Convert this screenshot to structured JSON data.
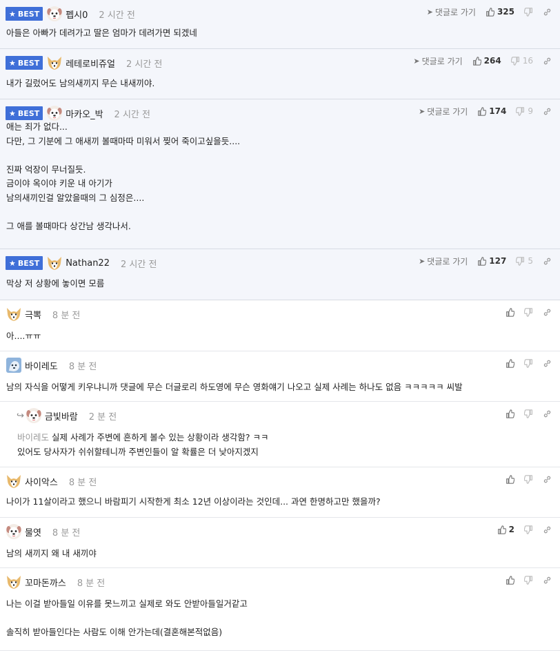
{
  "labels": {
    "best": "BEST",
    "goto": "댓글로 가기"
  },
  "comments": [
    {
      "nick": "펩시0",
      "time": "2 시간 전",
      "best": true,
      "avatar": "dog-face",
      "up": "325",
      "down": "",
      "lines": [
        "아들은 아빠가 데려가고 딸은 엄마가 데려가면 되겠네"
      ]
    },
    {
      "nick": "레테로비쥬얼",
      "time": "2 시간 전",
      "best": true,
      "avatar": "fox-face",
      "up": "264",
      "down": "16",
      "lines": [
        "내가 길렀어도 남의새끼지 무슨 내새끼야."
      ]
    },
    {
      "nick": "마카오_박",
      "time": "2 시간 전",
      "best": true,
      "avatar": "dog-face",
      "up": "174",
      "down": "9",
      "lines": [
        "애는 죄가 없다...",
        "다만, 그 기분에 그 애새끼 볼때마따 미워서 찢어 죽이고싶을듯....",
        "",
        "진짜 억장이 무너질듯.",
        "금이야 옥이야 키운 내 아기가",
        "남의새끼인걸 알았을때의 그 심정은....",
        "",
        "그 애를 볼때마다 상간남 생각나서."
      ]
    },
    {
      "nick": "Nathan22",
      "time": "2 시간 전",
      "best": true,
      "avatar": "fox-face",
      "up": "127",
      "down": "5",
      "lines": [
        "막상 저 상황에 놓이면 모름"
      ]
    },
    {
      "nick": "극뽁",
      "time": "8 분 전",
      "best": false,
      "avatar": "fox-face",
      "up": "",
      "down": "",
      "lines": [
        "아....ㅠㅠ"
      ]
    },
    {
      "nick": "바이레도",
      "time": "8 분 전",
      "best": false,
      "avatar": "blue-face",
      "up": "",
      "down": "",
      "lines": [
        "남의 자식을 어떻게 키우냐니까 댓글에 무슨 더글로리 하도영에 무슨 영화얘기 나오고 실제 사례는 하나도 없음 ㅋㅋㅋㅋㅋ 씨발"
      ]
    },
    {
      "nick": "금빛바람",
      "time": "2 분 전",
      "best": false,
      "reply": true,
      "avatar": "dog-face",
      "up": "",
      "down": "",
      "mention": "바이레도",
      "lines": [
        "실제 사례가 주변에 흔하게 볼수 있는 상황이라 생각함? ㅋㅋ",
        "있어도 당사자가 쉬쉬할테니까 주변인들이 알 확률은 더 낮아지겠지"
      ]
    },
    {
      "nick": "사이악스",
      "time": "8 분 전",
      "best": false,
      "avatar": "fox-face",
      "up": "",
      "down": "",
      "lines": [
        "나이가 11살이라고 했으니 바람피기 시작한게 최소 12년 이상이라는 것인데... 과연 한명하고만 했을까?"
      ]
    },
    {
      "nick": "물엿",
      "time": "8 분 전",
      "best": false,
      "avatar": "dog-face",
      "up": "2",
      "down": "",
      "lines": [
        "남의 새끼지 왜 내 새끼야"
      ]
    },
    {
      "nick": "꼬마돈까스",
      "time": "8 분 전",
      "best": false,
      "avatar": "fox-face",
      "up": "",
      "down": "",
      "lines": [
        "나는 이걸 받아들일 이유를 못느끼고 실제로 와도 안받아들일거같고",
        "",
        "솔직히 받아들인다는 사람도 이해 안가는데(결혼해본적없음)"
      ]
    }
  ],
  "colors": {
    "best_badge": "#3f6fd8",
    "best_bg": "#f4f6fb",
    "mention": "#999999"
  }
}
